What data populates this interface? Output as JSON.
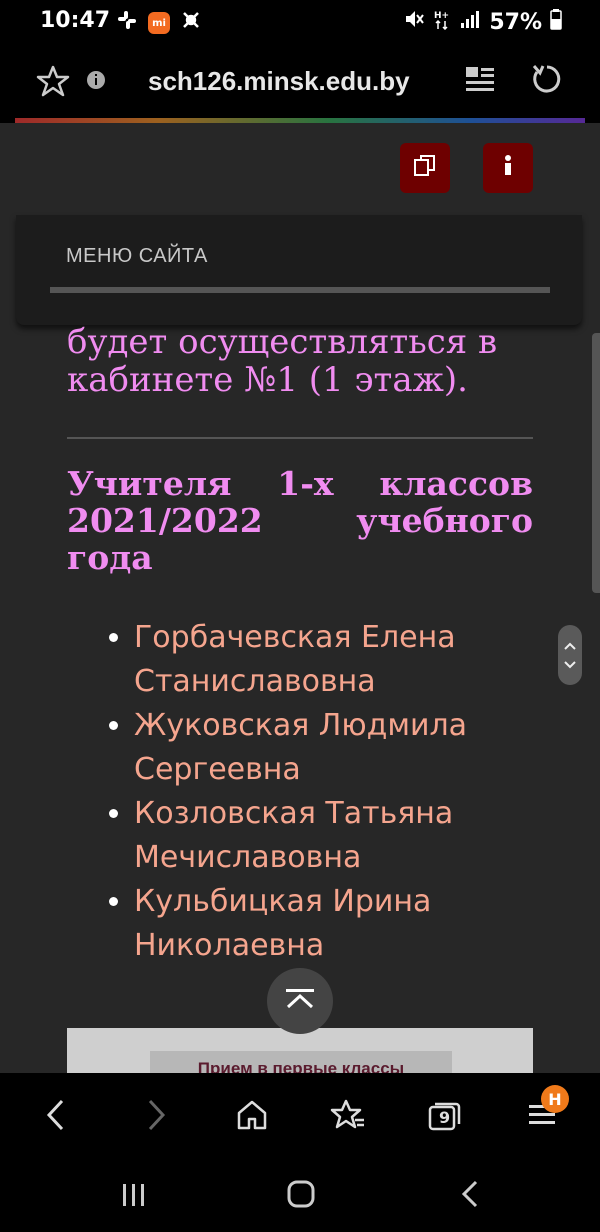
{
  "status_bar": {
    "time": "10:47",
    "battery": "57%",
    "mi_label": "mi"
  },
  "address_bar": {
    "url": "sch126.minsk.edu.by"
  },
  "site": {
    "menu_label": "МЕНЮ САЙТА",
    "content_text": "будет осуществляться в кабинете №1 (1 этаж).",
    "heading": "Учителя 1-х классов 2021/2022 учебного года",
    "teachers": [
      "Горбачевская Елена Станиславовна",
      "Жуковская Людмила Сергеевна",
      "Козловская Татьяна Мечиславовна",
      "Кульбицкая Ирина Николаевна"
    ],
    "banner_text": "Прием в первые классы"
  },
  "toolbar": {
    "tabs_count": "9",
    "menu_badge": "H"
  },
  "colors": {
    "page_bg": "#272727",
    "heading": "#f08cf0",
    "teacher_text": "#f5a58e",
    "tool_button": "#6e0000",
    "badge": "#f07a1a"
  }
}
